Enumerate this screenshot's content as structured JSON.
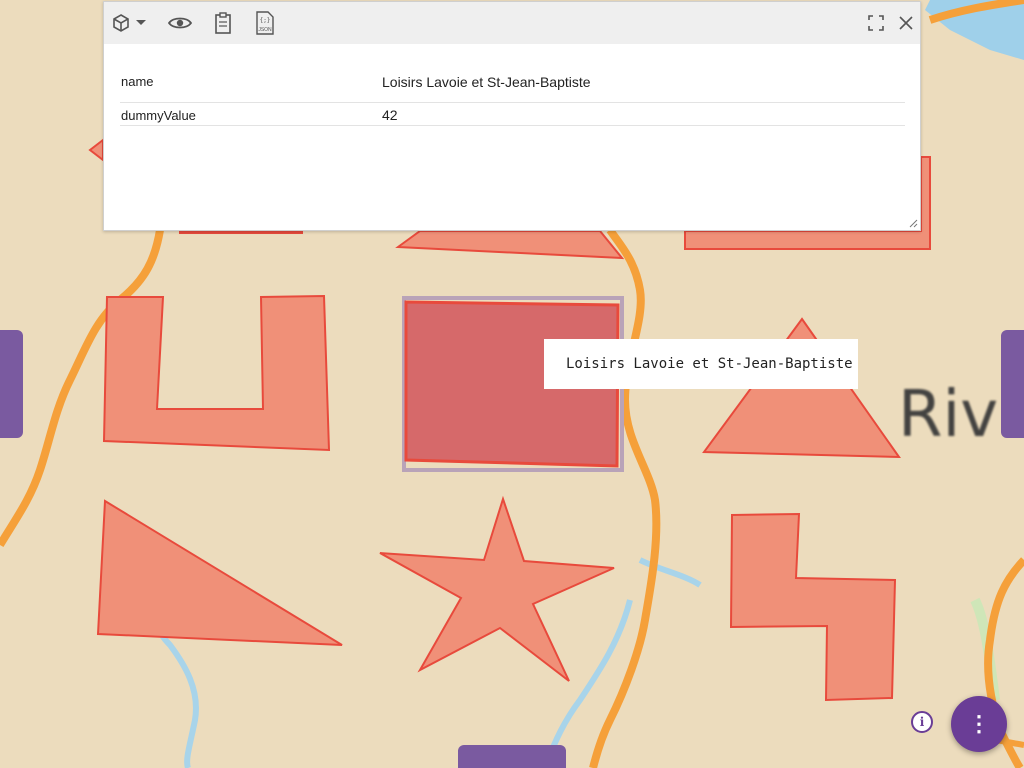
{
  "map": {
    "place_label": "Rivi",
    "tooltip": "Loisirs Lavoie et St-Jean-Baptiste",
    "colors": {
      "land": "#ecdcbd",
      "road": "#f5a03a",
      "river": "#a8d4ea",
      "water": "#9fd0ea",
      "polygon_fill": "#f09078",
      "polygon_stroke": "#e84a3c",
      "selected_fill": "#d6696a"
    }
  },
  "popup": {
    "toolbar": {
      "icons": [
        "cube-icon",
        "chevron-down-icon",
        "eye-icon",
        "clipboard-icon",
        "json-file-icon",
        "fullscreen-icon",
        "close-icon"
      ],
      "json_icon_text": "JSON"
    },
    "properties": [
      {
        "key": "name",
        "value": "Loisirs Lavoie et St-Jean-Baptiste"
      },
      {
        "key": "dummyValue",
        "value": "42"
      }
    ]
  },
  "controls": {
    "info_label": "i",
    "menu_label": "⋮",
    "accent": "#6a3d96"
  }
}
